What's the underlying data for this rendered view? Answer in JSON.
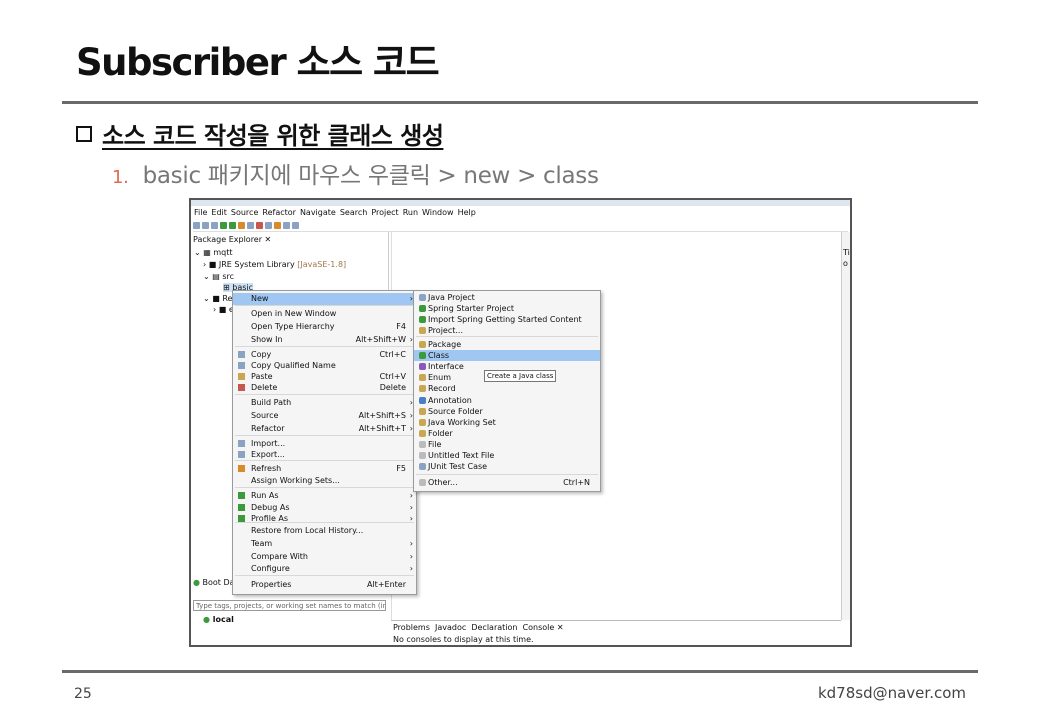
{
  "slide": {
    "title": "Subscriber 소스 코드",
    "heading": "소스 코드 작성을 위한 클래스 생성",
    "step_number": "1.",
    "step_text": "basic 패키지에 마우스 우클릭 > new > class",
    "page_number": "25",
    "footer_email": "kd78sd@naver.com"
  },
  "ide": {
    "menu": [
      "File",
      "Edit",
      "Source",
      "Refactor",
      "Navigate",
      "Search",
      "Project",
      "Run",
      "Window",
      "Help"
    ],
    "package_explorer": {
      "tab_label": "Package Explorer",
      "tree": [
        {
          "label": "mqtt"
        },
        {
          "label": "JRE System Library",
          "suffix": "[JavaSE-1.8]"
        },
        {
          "label": "src"
        },
        {
          "label": "basic"
        },
        {
          "label": "Ref"
        },
        {
          "label": "e"
        }
      ]
    },
    "boot_dashboard": {
      "tab_label": "Boot Das",
      "filter_placeholder": "Type tags, projects, or working set names to match (incl.",
      "local_label": "local"
    },
    "right_panel_chars": [
      "Ti",
      "o"
    ],
    "console": {
      "tabs": [
        "Problems",
        "Javadoc",
        "Declaration",
        "Console"
      ],
      "message": "No consoles to display at this time."
    },
    "context_menu": {
      "items": [
        {
          "label": "New",
          "shortcut": "",
          "has_submenu": true,
          "highlighted": true
        },
        {
          "label": "Open in New Window",
          "shortcut": ""
        },
        {
          "label": "Open Type Hierarchy",
          "shortcut": "F4"
        },
        {
          "label": "Show In",
          "shortcut": "Alt+Shift+W",
          "has_submenu": true
        },
        {
          "label": "Copy",
          "shortcut": "Ctrl+C"
        },
        {
          "label": "Copy Qualified Name",
          "shortcut": ""
        },
        {
          "label": "Paste",
          "shortcut": "Ctrl+V"
        },
        {
          "label": "Delete",
          "shortcut": "Delete"
        },
        {
          "label": "Build Path",
          "shortcut": "",
          "has_submenu": true
        },
        {
          "label": "Source",
          "shortcut": "Alt+Shift+S",
          "has_submenu": true
        },
        {
          "label": "Refactor",
          "shortcut": "Alt+Shift+T",
          "has_submenu": true
        },
        {
          "label": "Import...",
          "shortcut": ""
        },
        {
          "label": "Export...",
          "shortcut": ""
        },
        {
          "label": "Refresh",
          "shortcut": "F5"
        },
        {
          "label": "Assign Working Sets...",
          "shortcut": ""
        },
        {
          "label": "Run As",
          "shortcut": "",
          "has_submenu": true
        },
        {
          "label": "Debug As",
          "shortcut": "",
          "has_submenu": true
        },
        {
          "label": "Profile As",
          "shortcut": "",
          "has_submenu": true
        },
        {
          "label": "Restore from Local History...",
          "shortcut": ""
        },
        {
          "label": "Team",
          "shortcut": "",
          "has_submenu": true
        },
        {
          "label": "Compare With",
          "shortcut": "",
          "has_submenu": true
        },
        {
          "label": "Configure",
          "shortcut": "",
          "has_submenu": true
        },
        {
          "label": "Properties",
          "shortcut": "Alt+Enter"
        }
      ]
    },
    "new_submenu": {
      "items": [
        {
          "label": "Java Project"
        },
        {
          "label": "Spring Starter Project"
        },
        {
          "label": "Import Spring Getting Started Content"
        },
        {
          "label": "Project..."
        },
        {
          "label": "Package"
        },
        {
          "label": "Class",
          "highlighted": true
        },
        {
          "label": "Interface"
        },
        {
          "label": "Enum"
        },
        {
          "label": "Record"
        },
        {
          "label": "Annotation"
        },
        {
          "label": "Source Folder"
        },
        {
          "label": "Java Working Set"
        },
        {
          "label": "Folder"
        },
        {
          "label": "File"
        },
        {
          "label": "Untitled Text File"
        },
        {
          "label": "JUnit Test Case"
        },
        {
          "label": "Other...",
          "shortcut": "Ctrl+N"
        }
      ]
    },
    "tooltip": "Create a Java class",
    "colors": {
      "highlight": "#9fc7f2",
      "slide_rule": "#6a6a6a",
      "step_number": "#e36a4f",
      "jre_suffix": "#a0784a"
    }
  }
}
